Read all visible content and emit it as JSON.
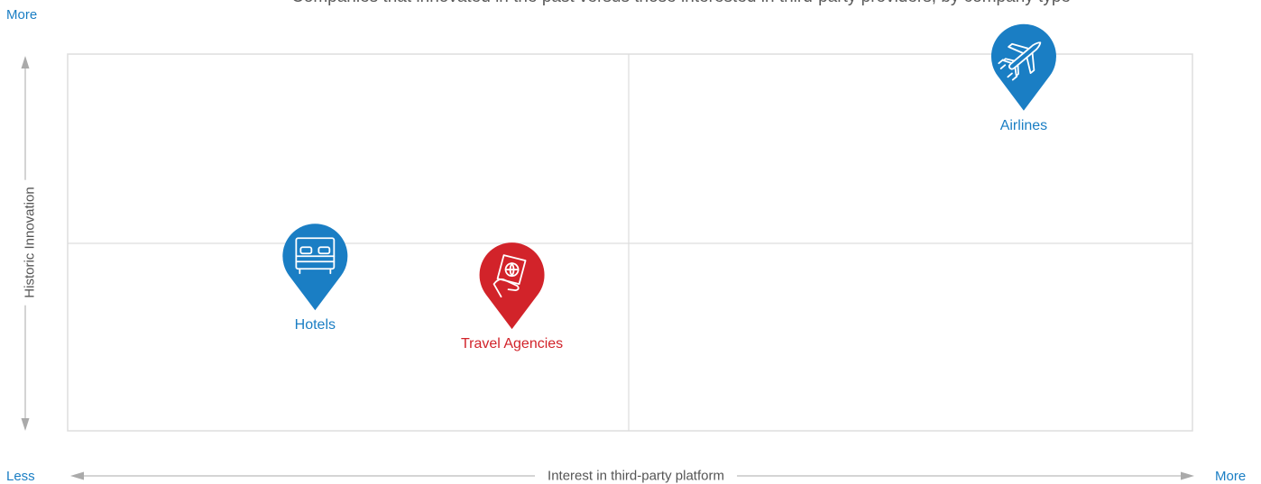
{
  "subtitle": "Companies that innovated in the past versus those interested in third-party providers, by company type",
  "corner_labels": {
    "y_top": "More",
    "x_left": "Less",
    "x_right": "More"
  },
  "chart_data": {
    "type": "scatter",
    "title": "",
    "subtitle": "Companies that innovated in the past versus those interested in third-party providers, by company type",
    "xlabel": "Interest in third-party platform",
    "ylabel": "Historic Innovation",
    "xlim": [
      0,
      1
    ],
    "ylim": [
      0,
      1
    ],
    "grid": "quadrants",
    "points": [
      {
        "label": "Airlines",
        "x": 0.85,
        "y": 0.85,
        "icon": "airplane-icon",
        "color": "#1a7ec4"
      },
      {
        "label": "Hotels",
        "x": 0.22,
        "y": 0.32,
        "icon": "bed-icon",
        "color": "#1a7ec4"
      },
      {
        "label": "Travel Agencies",
        "x": 0.395,
        "y": 0.27,
        "icon": "passport-hand-icon",
        "color": "#d2232a"
      }
    ]
  },
  "colors": {
    "accent_blue": "#1a7ec4",
    "accent_red": "#d2232a",
    "grid": "#dddddd",
    "axis": "#aaaaaa"
  }
}
